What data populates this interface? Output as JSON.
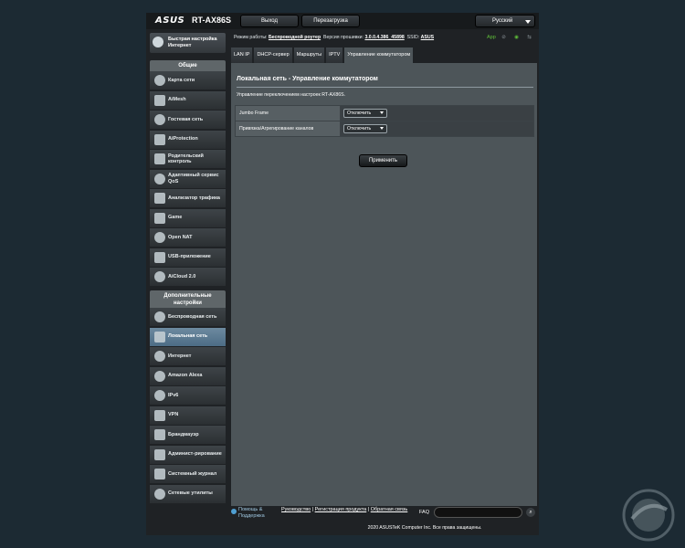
{
  "header": {
    "brand": "ASUS",
    "model": "RT-AX86S",
    "logout_label": "Выход",
    "reboot_label": "Перезагрузка",
    "language": "Русский"
  },
  "sidebar": {
    "quick_setup": "Быстрая настройка Интернет",
    "general_title": "Общие",
    "general_items": [
      {
        "label": "Карта сети",
        "icon": "network-map-icon"
      },
      {
        "label": "AiMesh",
        "icon": "aimesh-icon"
      },
      {
        "label": "Гостевая сеть",
        "icon": "guest-network-icon"
      },
      {
        "label": "AiProtection",
        "icon": "aiprotection-icon"
      },
      {
        "label": "Родительский контроль",
        "icon": "parental-control-icon"
      },
      {
        "label": "Адаптивный сервис QoS",
        "icon": "qos-icon"
      },
      {
        "label": "Анализатор трафика",
        "icon": "traffic-analyzer-icon"
      },
      {
        "label": "Game",
        "icon": "gamepad-icon"
      },
      {
        "label": "Open NAT",
        "icon": "open-nat-icon"
      },
      {
        "label": "USB-приложение",
        "icon": "usb-icon"
      },
      {
        "label": "AiCloud 2.0",
        "icon": "cloud-icon"
      }
    ],
    "advanced_title": "Дополнительные настройки",
    "advanced_items": [
      {
        "label": "Беспроводная сеть",
        "icon": "wireless-icon"
      },
      {
        "label": "Локальная сеть",
        "icon": "lan-icon"
      },
      {
        "label": "Интернет",
        "icon": "globe-icon"
      },
      {
        "label": "Amazon Alexa",
        "icon": "alexa-icon"
      },
      {
        "label": "IPv6",
        "icon": "ipv6-icon"
      },
      {
        "label": "VPN",
        "icon": "vpn-icon"
      },
      {
        "label": "Брандмауэр",
        "icon": "firewall-icon"
      },
      {
        "label": "Админист-рирование",
        "icon": "admin-icon"
      },
      {
        "label": "Системный журнал",
        "icon": "system-log-icon"
      },
      {
        "label": "Сетевые утилиты",
        "icon": "network-tools-icon"
      }
    ],
    "active_item": "Локальная сеть"
  },
  "status_bar": {
    "mode_label": "Режим работы:",
    "mode_value": "Беспроводной роутер",
    "firmware_label": "Версия прошивки:",
    "firmware_value": "3.0.0.4.386_45898",
    "ssid_label": "SSID:",
    "ssid_value": "ASUS",
    "app_label": "App"
  },
  "tabs": [
    {
      "label": "LAN IP"
    },
    {
      "label": "DHCP-сервер"
    },
    {
      "label": "Маршруты"
    },
    {
      "label": "IPTV"
    },
    {
      "label": "Управление коммутатором"
    }
  ],
  "active_tab": "Управление коммутатором",
  "main": {
    "title": "Локальная сеть - Управление коммутатором",
    "description": "Управление переключением настроек RT-AX86S.",
    "fields": [
      {
        "label": "Jumbo Frame",
        "value": "Отключить"
      },
      {
        "label": "Привязка/Агрегирование каналов",
        "value": "Отключить"
      }
    ],
    "apply_label": "Применить"
  },
  "footer": {
    "help_label": "Помощь & Поддержка",
    "links": [
      "Руководство",
      "Регистрация продукта",
      "Обратная связь"
    ],
    "faq_label": "FAQ",
    "copyright": "2020 ASUSTeK Computer Inc. Все права защищены."
  }
}
